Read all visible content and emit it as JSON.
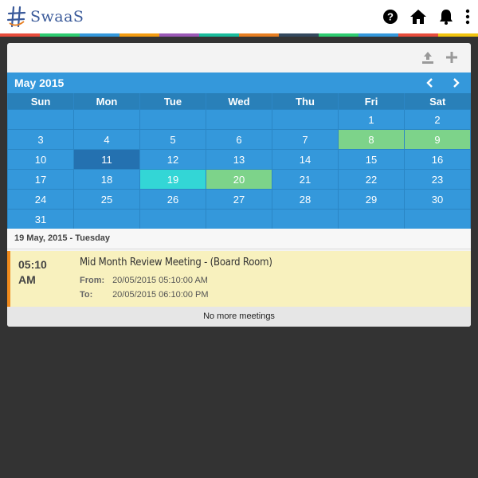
{
  "app": {
    "logo_text": "SwaaS",
    "icons": [
      "help-icon",
      "home-icon",
      "bell-icon",
      "more-vertical-icon"
    ],
    "stripe_colors": [
      "#e74c3c",
      "#2ecc71",
      "#3498db",
      "#f39c12",
      "#9b59b6",
      "#1abc9c",
      "#e67e22",
      "#34495e",
      "#2ecc71",
      "#3498db",
      "#e74c3c",
      "#f1c40f"
    ]
  },
  "toolbar": {
    "icons": [
      "upload-icon",
      "add-icon"
    ]
  },
  "calendar": {
    "month_title": "May 2015",
    "weekdays": [
      "Sun",
      "Mon",
      "Tue",
      "Wed",
      "Thu",
      "Fri",
      "Sat"
    ],
    "weeks": [
      [
        "",
        "",
        "",
        "",
        "",
        "1",
        "2"
      ],
      [
        "3",
        "4",
        "5",
        "6",
        "7",
        "8",
        "9"
      ],
      [
        "10",
        "11",
        "12",
        "13",
        "14",
        "15",
        "16"
      ],
      [
        "17",
        "18",
        "19",
        "20",
        "21",
        "22",
        "23"
      ],
      [
        "24",
        "25",
        "26",
        "27",
        "28",
        "29",
        "30"
      ],
      [
        "31",
        "",
        "",
        "",
        "",
        "",
        ""
      ]
    ],
    "highlight": {
      "selected": [
        "11"
      ],
      "today": [
        "19"
      ],
      "meeting_days": [
        "8",
        "9",
        "20"
      ]
    },
    "colors": {
      "header": "#3498db",
      "selected": "#2471b0",
      "today": "#33d6d6",
      "meeting": "#7dd38a"
    }
  },
  "day_header": "19 May, 2015 - Tuesday",
  "meeting": {
    "time": "05:10 AM",
    "title": "Mid Month Review Meeting - (Board Room)",
    "from_label": "From:",
    "from_value": "20/05/2015 05:10:00 AM",
    "to_label": "To:",
    "to_value": "20/05/2015 06:10:00 PM",
    "accent": "#f08a1c"
  },
  "footer_text": "No more meetings"
}
